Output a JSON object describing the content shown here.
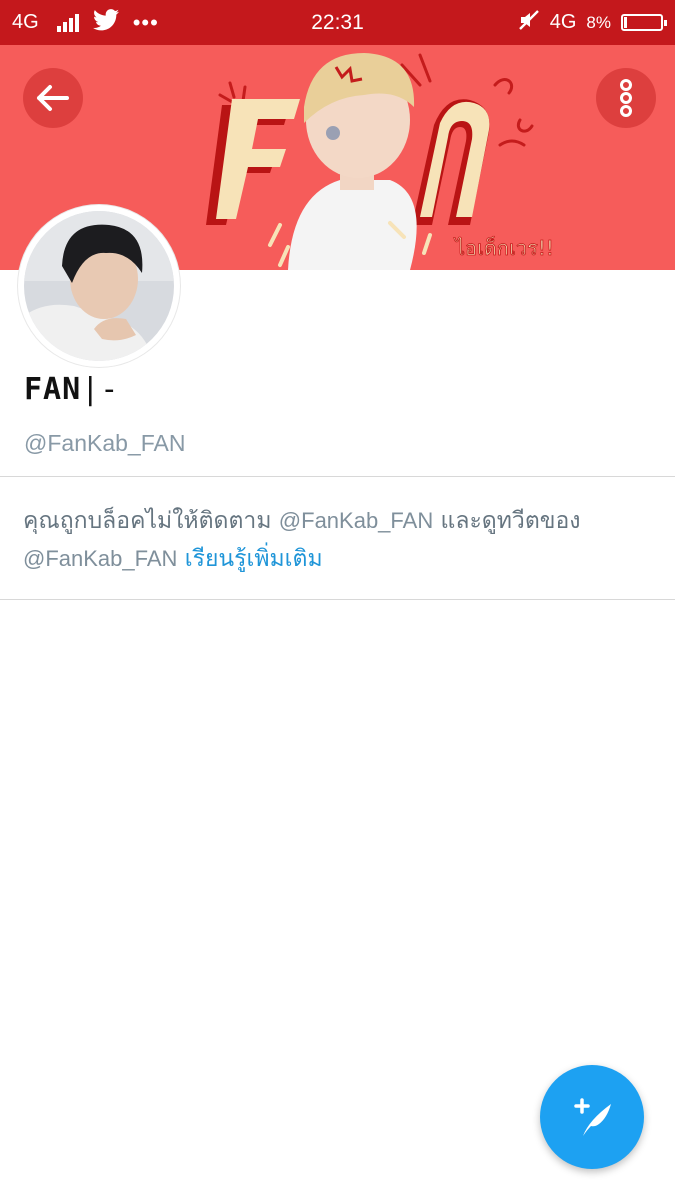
{
  "status_bar": {
    "network_left": "4G",
    "time": "22:31",
    "network_right": "4G",
    "battery": "8%",
    "battery_level": 0.08
  },
  "banner": {
    "art_text": "FAN",
    "art_caption": "ไอเด็กเวร!!"
  },
  "profile": {
    "display_name": "FAN",
    "display_suffix": "|-",
    "handle": "@FanKab_FAN"
  },
  "notice": {
    "text_1": "คุณถูกบล็อคไม่ให้ติดตาม",
    "handle_1": "@FanKab_FAN",
    "text_2": "และดูทวีตของ",
    "handle_2": "@FanKab_FAN",
    "link": "เรียนรู้เพิ่มเติม"
  },
  "colors": {
    "status_bar": "#c4181c",
    "banner": "#f65c5a",
    "link": "#1f95d8",
    "fab": "#1da1f2"
  },
  "icons": {
    "back": "arrow-left-icon",
    "more": "more-vertical-icon",
    "compose": "compose-tweet-icon",
    "twitter": "twitter-bird-icon"
  }
}
